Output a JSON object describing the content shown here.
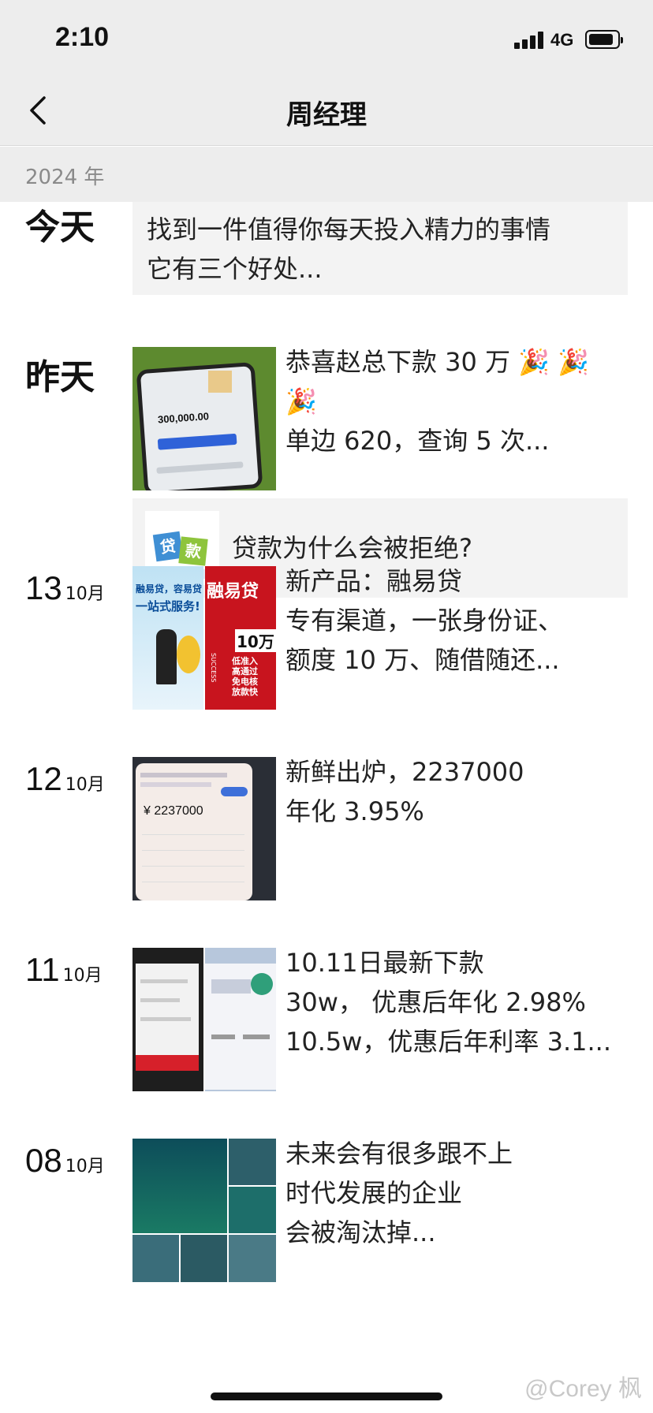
{
  "status": {
    "time": "2:10",
    "network": "4G"
  },
  "header": {
    "title": "周经理",
    "back_icon": "chevron-left-icon"
  },
  "year": "2024 年",
  "entries": [
    {
      "date_word": "今天",
      "lines": [
        "找到一件值得你每天投入精力的事情",
        "它有三个好处..."
      ]
    },
    {
      "date_word": "昨天",
      "lines": [
        "恭喜赵总下款 30 万 🎉 🎉",
        "🎉",
        "单边 620，查询 5 次..."
      ],
      "thumb_texts": [
        "300,000.00"
      ],
      "link": {
        "title": "贷款为什么会被拒绝?",
        "thumb_text": "贷款"
      }
    },
    {
      "day": "13",
      "month": "10月",
      "lines": [
        "新产品：融易贷",
        "专有渠道，一张身份证、",
        "额度 10 万、随借随还..."
      ],
      "thumb_texts": [
        "融易贷，容易贷",
        "一站式服务!",
        "融易贷",
        "10万",
        "低准入",
        "高通过",
        "免电核",
        "放款快",
        "SUCCESS"
      ]
    },
    {
      "day": "12",
      "month": "10月",
      "lines": [
        "新鲜出炉，2237000",
        "年化 3.95%"
      ],
      "thumb_texts": [
        "¥ 2237000"
      ]
    },
    {
      "day": "11",
      "month": "10月",
      "lines": [
        "10.11日最新下款",
        "30w，  优惠后年化 2.98%",
        "10.5w，优惠后年利率 3.1..."
      ]
    },
    {
      "day": "08",
      "month": "10月",
      "lines": [
        "未来会有很多跟不上",
        "时代发展的企业",
        "会被淘汰掉..."
      ]
    }
  ],
  "watermark": "@Corey 枫"
}
